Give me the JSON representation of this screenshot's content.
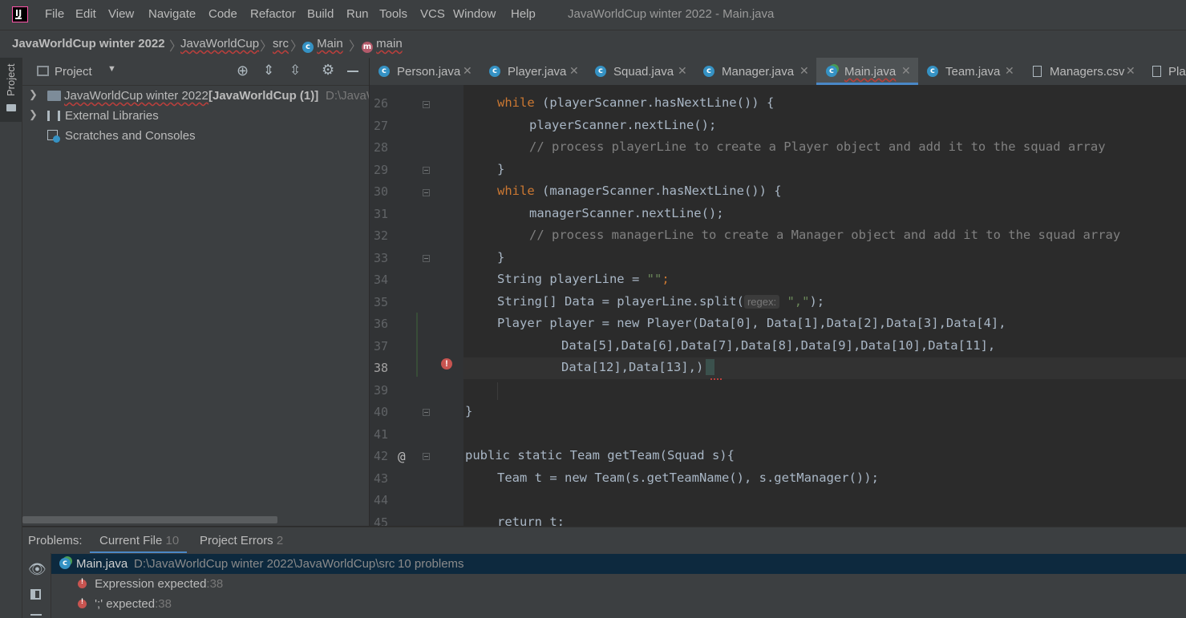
{
  "menu": {
    "items": [
      "File",
      "Edit",
      "View",
      "Navigate",
      "Code",
      "Refactor",
      "Build",
      "Run",
      "Tools",
      "VCS",
      "Window",
      "Help"
    ],
    "window_title": "JavaWorldCup winter 2022 - Main.java"
  },
  "breadcrumb": {
    "project": "JavaWorldCup winter 2022",
    "module": "JavaWorldCup",
    "folder": "src",
    "class": "Main",
    "method": "main"
  },
  "project_panel": {
    "side_tab": "Project",
    "title": "Project",
    "tree": {
      "root_name": "JavaWorldCup winter 2022",
      "root_module": "[JavaWorldCup (1)]",
      "root_path": "D:\\JavaW",
      "external_libraries": "External Libraries",
      "scratches": "Scratches and Consoles"
    }
  },
  "tabs": [
    {
      "label": "Person.java",
      "icon": "class-icon"
    },
    {
      "label": "Player.java",
      "icon": "class-icon"
    },
    {
      "label": "Squad.java",
      "icon": "class-icon"
    },
    {
      "label": "Manager.java",
      "icon": "class-icon"
    },
    {
      "label": "Main.java",
      "icon": "class-run-icon",
      "active": true
    },
    {
      "label": "Team.java",
      "icon": "class-icon"
    },
    {
      "label": "Managers.csv",
      "icon": "text-file-icon"
    },
    {
      "label": "Pla",
      "icon": "text-file-icon"
    }
  ],
  "editor": {
    "line_numbers": [
      "26",
      "27",
      "28",
      "29",
      "30",
      "31",
      "32",
      "33",
      "34",
      "35",
      "36",
      "37",
      "38",
      "39",
      "40",
      "41",
      "42",
      "43",
      "44",
      "45"
    ],
    "lines": {
      "l26a": "while",
      "l26b": " (playerScanner.hasNextLine()) {",
      "l27": "playerScanner.nextLine();",
      "l28": "// process playerLine to create a Player object and add it to the squad array",
      "l29": "}",
      "l30a": "while",
      "l30b": " (managerScanner.hasNextLine()) {",
      "l31": "managerScanner.nextLine();",
      "l32": "// process managerLine to create a Manager object and add it to the squad array",
      "l33": "}",
      "l34a": "String playerLine = ",
      "l34b": "\"\"",
      "l34c": ";",
      "l35a": "String[] Data = playerLine.split(",
      "l35hint": "regex:",
      "l35b": "\",\"",
      "l35c": ");",
      "l36": "Player player = new Player(Data[0], Data[1],Data[2],Data[3],Data[4],",
      "l37": "Data[5],Data[6],Data[7],Data[8],Data[9],Data[10],Data[11],",
      "l38": "Data[12],Data[13],)",
      "l40": "}",
      "l42": "public static Team getTeam(Squad s){",
      "l43": "Team t = new Team(s.getTeamName(), s.getManager());",
      "l45": "return t;"
    }
  },
  "problems": {
    "label": "Problems:",
    "tab_current": "Current File",
    "tab_current_count": "10",
    "tab_project": "Project Errors",
    "tab_project_count": "2",
    "file_name": "Main.java",
    "file_path": "D:\\JavaWorldCup winter 2022\\JavaWorldCup\\src",
    "file_summary": "10 problems",
    "items": [
      {
        "text": "Expression expected",
        "location": ":38"
      },
      {
        "text": "';' expected",
        "location": ":38"
      }
    ]
  }
}
